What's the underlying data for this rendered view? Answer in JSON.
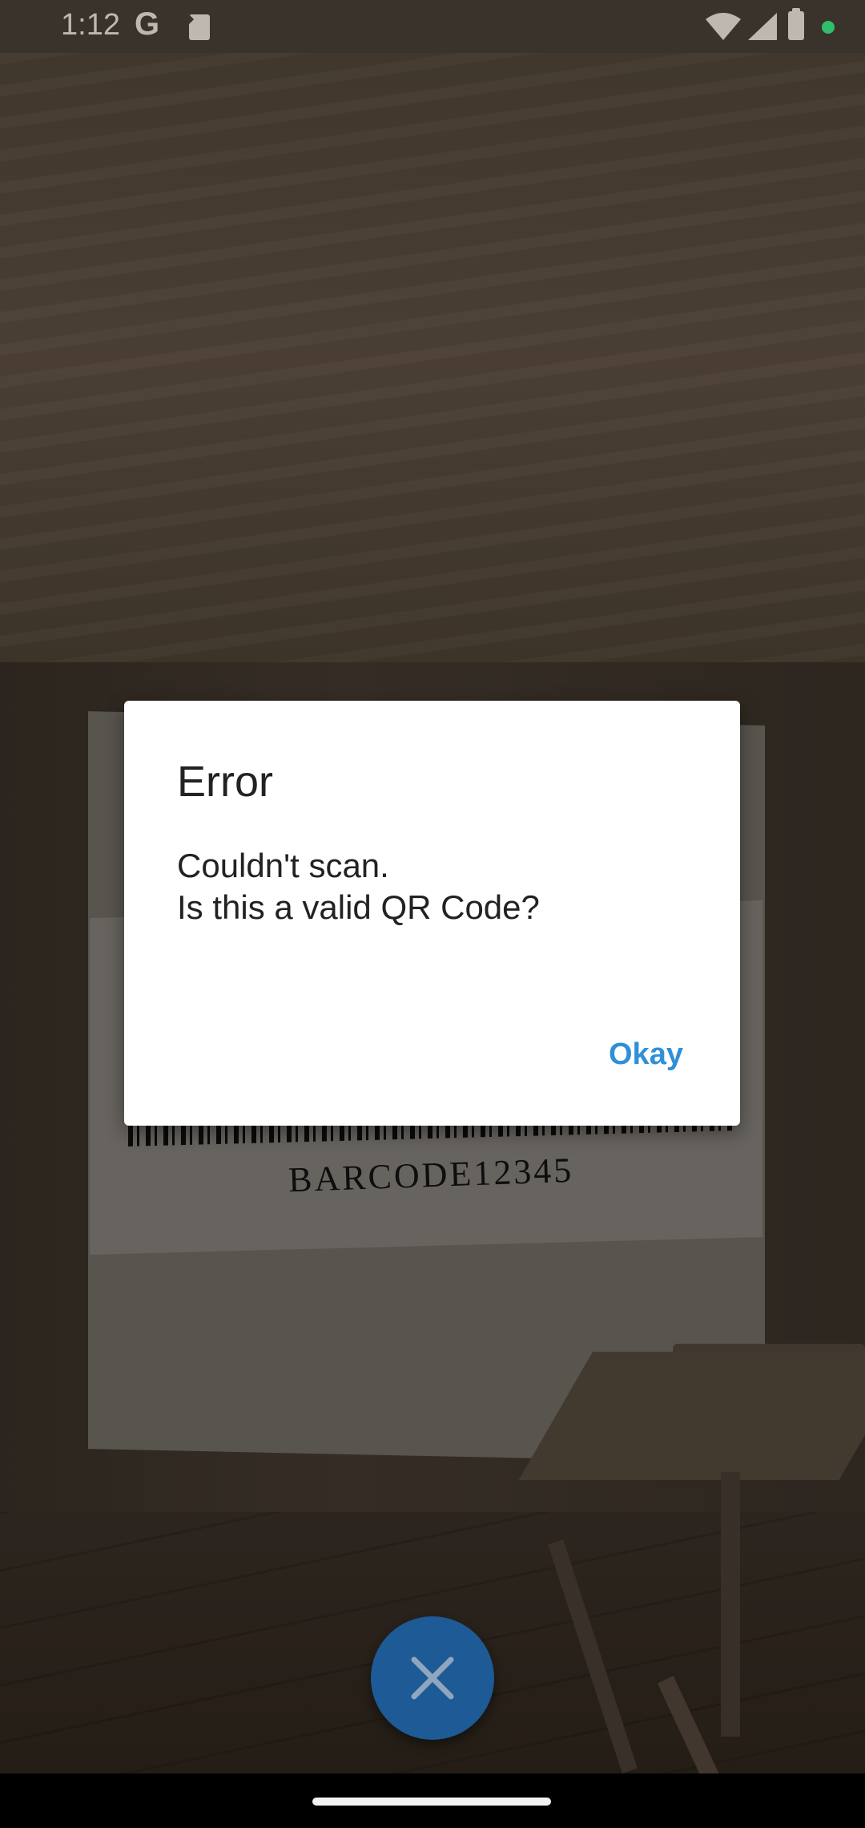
{
  "status_bar": {
    "time": "1:12",
    "google_glyph": "G",
    "icons": [
      "google-icon",
      "sd-card-icon",
      "wifi-icon",
      "signal-icon",
      "battery-icon",
      "privacy-dot-icon"
    ],
    "privacy_dot_color": "#2fbf6c"
  },
  "camera": {
    "barcode_text": "BARCODE12345"
  },
  "dialog": {
    "title": "Error",
    "message": "Couldn't scan.\nIs this a valid QR Code?",
    "button_label": "Okay",
    "button_color": "#2f90d8"
  },
  "fab": {
    "icon": "close-icon",
    "color": "#1d5a96"
  }
}
